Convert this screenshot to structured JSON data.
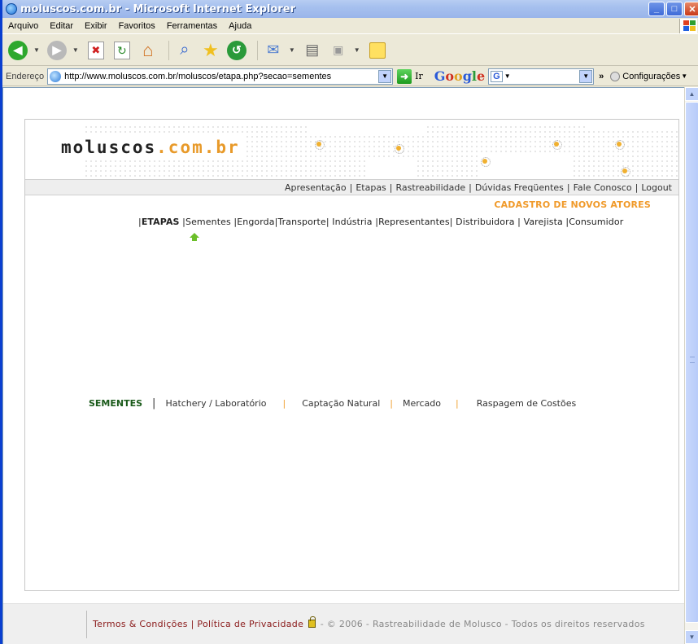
{
  "window": {
    "title": "moluscos.com.br - Microsoft Internet Explorer"
  },
  "menu": [
    "Arquivo",
    "Editar",
    "Exibir",
    "Favoritos",
    "Ferramentas",
    "Ajuda"
  ],
  "address": {
    "label": "Endereço",
    "url": "http://www.moluscos.com.br/moluscos/etapa.php?secao=sementes",
    "go_label": "Ir"
  },
  "google_bar": {
    "logo": "Google",
    "g_icon": "G",
    "chevron": "»",
    "settings_label": "Configurações"
  },
  "site": {
    "logo_main": "moluscos",
    "logo_accent": ".com.br",
    "top_nav": [
      "Apresentação",
      "Etapas",
      "Rastreabilidade",
      "Dúvidas Freqüentes",
      "Fale Conosco",
      "Logout"
    ],
    "cadastro_label": "CADASTRO DE NOVOS ATORES",
    "etapas": {
      "title": "ETAPAS",
      "items": [
        "Sementes",
        "Engorda",
        "Transporte",
        "Indústria",
        "Representantes",
        "Distribuidora",
        "Varejista",
        "Consumidor"
      ]
    },
    "sementes": {
      "active": "SEMENTES",
      "items": [
        "Hatchery / Laboratório",
        "Captação Natural",
        "Mercado",
        "Raspagem de Costões"
      ]
    },
    "footer": {
      "terms": "Termos & Condições",
      "privacy": "Política de Privacidade",
      "copyright": "- © 2006 - Rastreabilidade de Molusco - Todos os direitos reservados"
    }
  },
  "colors": {
    "accent_orange": "#f09a2a",
    "active_green": "#1a5a1a",
    "arrow_green": "#6cbf2a",
    "footer_link": "#8a1a1a"
  }
}
